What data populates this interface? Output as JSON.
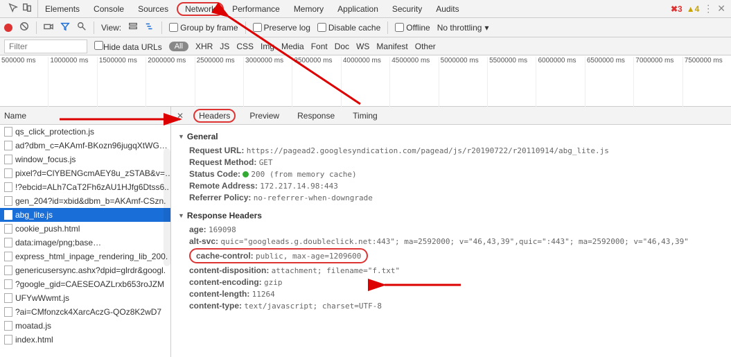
{
  "tabs": {
    "items": [
      "Elements",
      "Console",
      "Sources",
      "Network",
      "Performance",
      "Memory",
      "Application",
      "Security",
      "Audits"
    ],
    "active": "Network"
  },
  "badges": {
    "errors": "3",
    "warnings": "4"
  },
  "toolbar": {
    "view_label": "View:",
    "group_by_frame": "Group by frame",
    "preserve_log": "Preserve log",
    "disable_cache": "Disable cache",
    "offline": "Offline",
    "throttling": "No throttling"
  },
  "filterbar": {
    "placeholder": "Filter",
    "hide_data_urls": "Hide data URLs",
    "types": [
      "All",
      "XHR",
      "JS",
      "CSS",
      "Img",
      "Media",
      "Font",
      "Doc",
      "WS",
      "Manifest",
      "Other"
    ]
  },
  "timeline_ticks": [
    "500000 ms",
    "1000000 ms",
    "1500000 ms",
    "2000000 ms",
    "2500000 ms",
    "3000000 ms",
    "3500000 ms",
    "4000000 ms",
    "4500000 ms",
    "5000000 ms",
    "5500000 ms",
    "6000000 ms",
    "6500000 ms",
    "7000000 ms",
    "7500000 ms"
  ],
  "left_header": "Name",
  "files": [
    "qs_click_protection.js",
    "ad?dbm_c=AKAmf-BKozn96jugqXtWG…",
    "window_focus.js",
    "pixel?d=ClYBENGcmAEY8u_zSTAB&v=…",
    "!?ebcid=ALh7CaT2Fh6zAU1HJfg6Dtss6..",
    "gen_204?id=xbid&dbm_b=AKAmf-CSzn.",
    "abg_lite.js",
    "cookie_push.html",
    "data:image/png;base…",
    "express_html_inpage_rendering_lib_200.",
    "genericusersync.ashx?dpid=glrdr&googl.",
    "?google_gid=CAESEOAZLrxb653roJZM",
    "UFYwWwmt.js",
    "?ai=CMfonzck4XarcAczG-QOz8K2wD7",
    "moatad.js",
    "index.html"
  ],
  "selected_index": 6,
  "detail_tabs": [
    "Headers",
    "Preview",
    "Response",
    "Timing"
  ],
  "general": {
    "title": "General",
    "request_url_label": "Request URL:",
    "request_url": "https://pagead2.googlesyndication.com/pagead/js/r20190722/r20110914/abg_lite.js",
    "request_method_label": "Request Method:",
    "request_method": "GET",
    "status_code_label": "Status Code:",
    "status_code": "200  (from memory cache)",
    "remote_address_label": "Remote Address:",
    "remote_address": "172.217.14.98:443",
    "referrer_policy_label": "Referrer Policy:",
    "referrer_policy": "no-referrer-when-downgrade"
  },
  "response_headers": {
    "title": "Response Headers",
    "rows": [
      {
        "k": "age:",
        "v": "169098"
      },
      {
        "k": "alt-svc:",
        "v": "quic=\"googleads.g.doubleclick.net:443\"; ma=2592000; v=\"46,43,39\",quic=\":443\"; ma=2592000; v=\"46,43,39\""
      },
      {
        "k": "cache-control:",
        "v": "public, max-age=1209600"
      },
      {
        "k": "content-disposition:",
        "v": "attachment; filename=\"f.txt\""
      },
      {
        "k": "content-encoding:",
        "v": "gzip"
      },
      {
        "k": "content-length:",
        "v": "11264"
      },
      {
        "k": "content-type:",
        "v": "text/javascript; charset=UTF-8"
      }
    ],
    "highlight_index": 2
  }
}
